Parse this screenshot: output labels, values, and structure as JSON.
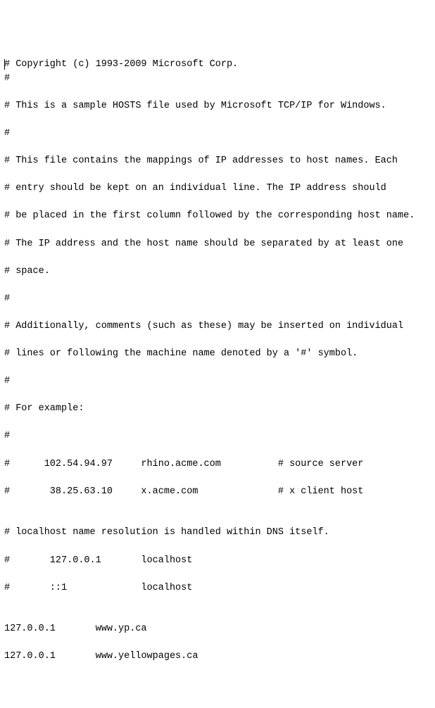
{
  "lines": {
    "l0": "# Copyright (c) 1993-2009 Microsoft Corp.",
    "l1": "#",
    "l2": "# This is a sample HOSTS file used by Microsoft TCP/IP for Windows.",
    "l3": "#",
    "l4": "# This file contains the mappings of IP addresses to host names. Each",
    "l5": "# entry should be kept on an individual line. The IP address should",
    "l6": "# be placed in the first column followed by the corresponding host name.",
    "l7": "# The IP address and the host name should be separated by at least one",
    "l8": "# space.",
    "l9": "#",
    "l10": "# Additionally, comments (such as these) may be inserted on individual",
    "l11": "# lines or following the machine name denoted by a '#' symbol.",
    "l12": "#",
    "l13": "# For example:",
    "l14": "#",
    "l15": "#      102.54.94.97     rhino.acme.com          # source server",
    "l16": "#       38.25.63.10     x.acme.com              # x client host",
    "l17": "",
    "l18": "# localhost name resolution is handled within DNS itself.",
    "l19": "#       127.0.0.1       localhost",
    "l20": "#       ::1             localhost",
    "l21": "",
    "l22": "127.0.0.1       www.yp.ca",
    "l23": "127.0.0.1       www.yellowpages.ca"
  }
}
